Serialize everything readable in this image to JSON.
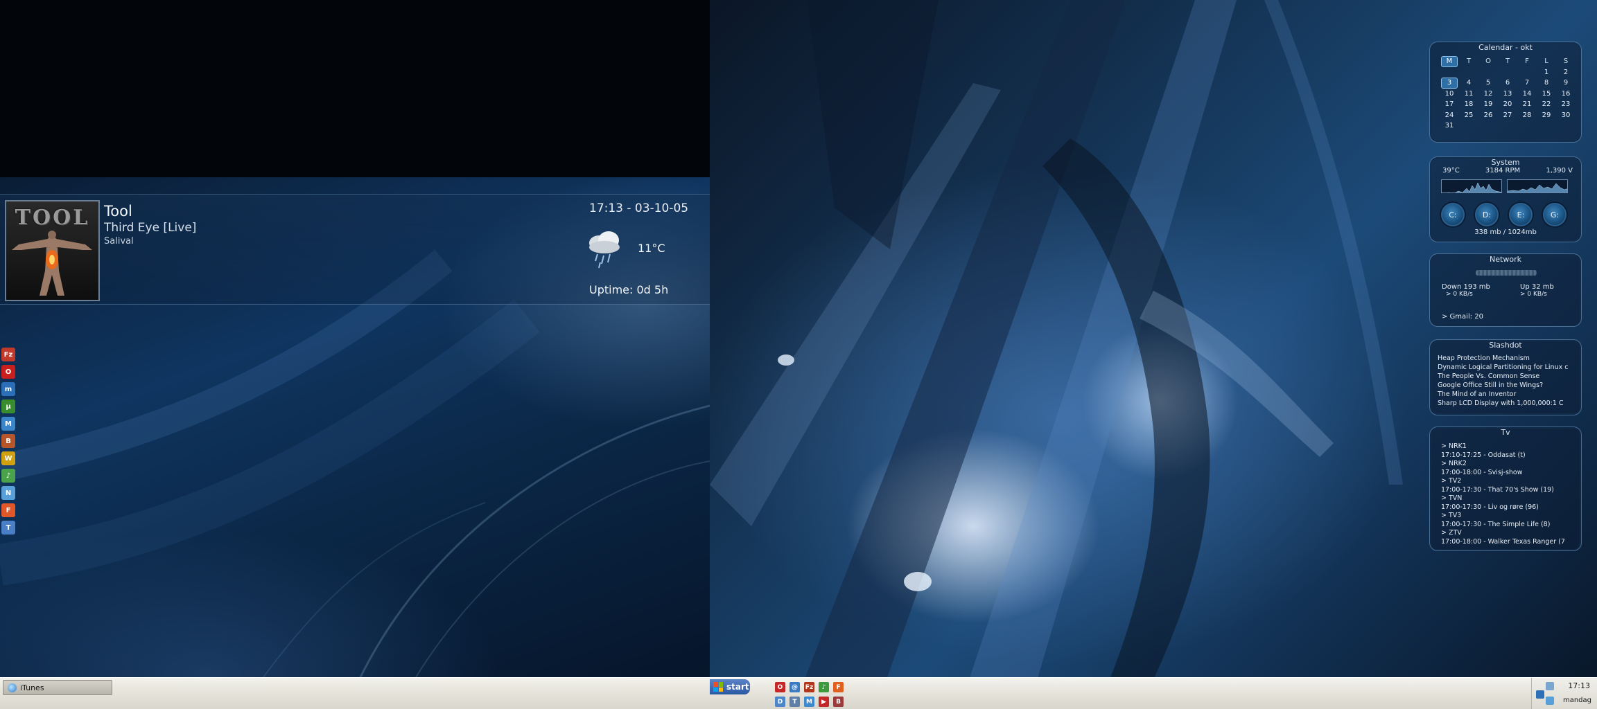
{
  "now_playing": {
    "artist": "Tool",
    "title": "Third Eye [Live]",
    "album": "Salival",
    "album_art_text": "TOOL"
  },
  "clock_date": "17:13 - 03-10-05",
  "weather": {
    "temperature": "11°C",
    "icon": "rain-cloud-icon"
  },
  "uptime": "Uptime: 0d 5h",
  "quicklaunch": [
    {
      "icon": "filezilla-icon",
      "color": "#c0392b",
      "text": "Fz"
    },
    {
      "icon": "opera-icon",
      "color": "#c81e1e",
      "text": "O"
    },
    {
      "icon": "mirc-icon",
      "color": "#2a6fb8",
      "text": "m"
    },
    {
      "icon": "utorrent-icon",
      "color": "#3a8d2f",
      "text": "µ"
    },
    {
      "icon": "messenger-icon",
      "color": "#3a86c8",
      "text": "M"
    },
    {
      "icon": "books-icon",
      "color": "#b7552a",
      "text": "B"
    },
    {
      "icon": "winamp-icon",
      "color": "#d0a010",
      "text": "W"
    },
    {
      "icon": "itunes-icon",
      "color": "#4aa24a",
      "text": "♪"
    },
    {
      "icon": "network-icon",
      "color": "#5aa0d8",
      "text": "N"
    },
    {
      "icon": "firefox-icon",
      "color": "#e0582a",
      "text": "F"
    },
    {
      "icon": "thunderbird-icon",
      "color": "#4a7fc8",
      "text": "T"
    }
  ],
  "left_taskbar": {
    "task_label": "iTunes"
  },
  "calendar": {
    "title": "Calendar - okt",
    "headers": [
      "M",
      "T",
      "O",
      "T",
      "F",
      "L",
      "S"
    ],
    "weeks": [
      [
        "",
        "",
        "",
        "",
        "",
        "1",
        "2"
      ],
      [
        "3",
        "4",
        "5",
        "6",
        "7",
        "8",
        "9"
      ],
      [
        "10",
        "11",
        "12",
        "13",
        "14",
        "15",
        "16"
      ],
      [
        "17",
        "18",
        "19",
        "20",
        "21",
        "22",
        "23"
      ],
      [
        "24",
        "25",
        "26",
        "27",
        "28",
        "29",
        "30"
      ],
      [
        "31",
        "",
        "",
        "",
        "",
        "",
        ""
      ]
    ],
    "today": "3"
  },
  "system": {
    "title": "System",
    "temp": "39°C",
    "fan": "3184 RPM",
    "voltage": "1,390 V",
    "drives": [
      "C:",
      "D:",
      "E:",
      "G:"
    ],
    "memory": "338 mb / 1024mb"
  },
  "network": {
    "title": "Network",
    "down_total": "Down 193 mb",
    "down_rate": "> 0 KB/s",
    "up_total": "Up 32 mb",
    "up_rate": "> 0 KB/s",
    "gmail": "> Gmail: 20"
  },
  "slashdot": {
    "title": "Slashdot",
    "items": [
      "Heap Protection Mechanism",
      "Dynamic Logical Partitioning for Linux c",
      "The People Vs. Common Sense",
      "Google Office Still in the Wings?",
      "The Mind of an Inventor",
      "Sharp LCD Display with 1,000,000:1 C"
    ]
  },
  "tv": {
    "title": "Tv",
    "channels": [
      {
        "channel": "> NRK1",
        "show": "17:10-17:25 - Oddasat (t)"
      },
      {
        "channel": "> NRK2",
        "show": "17:00-18:00 - Svisj-show"
      },
      {
        "channel": "> TV2",
        "show": "17:00-17:30 - That 70's Show (19)"
      },
      {
        "channel": "> TVN",
        "show": "17:00-17:30 - Liv og røre (96)"
      },
      {
        "channel": "> TV3",
        "show": "17:00-17:30 - The Simple Life (8)"
      },
      {
        "channel": "> ZTV",
        "show": "17:00-18:00 - Walker Texas Ranger (7"
      }
    ]
  },
  "right_taskbar": {
    "start_label": "start",
    "clock": "17:13",
    "day": "mandag"
  }
}
